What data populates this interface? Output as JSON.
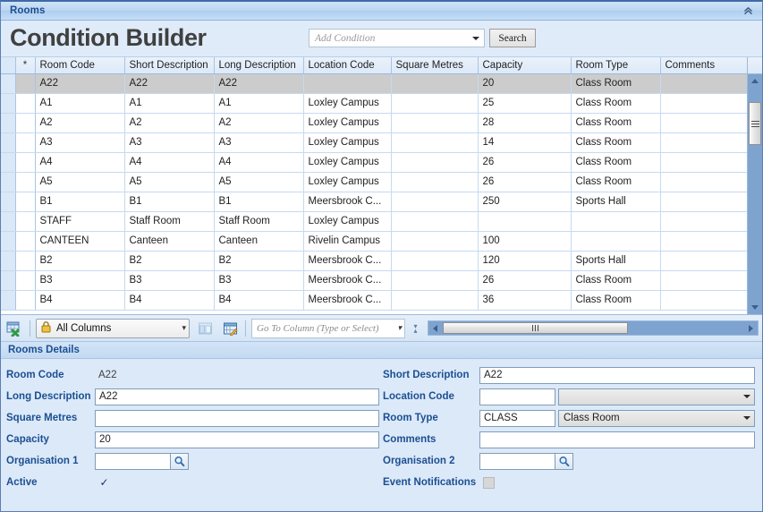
{
  "window": {
    "title": "Rooms",
    "collapse_icon": "chevron-double-up-icon"
  },
  "header": {
    "page_title": "Condition Builder",
    "condition_placeholder": "Add Condition",
    "condition_value": "",
    "search_label": "Search"
  },
  "grid": {
    "star_header": "*",
    "columns": [
      "Room Code",
      "Short Description",
      "Long Description",
      "Location Code",
      "Square Metres",
      "Capacity",
      "Room Type",
      "Comments"
    ],
    "rows": [
      {
        "selected": true,
        "cells": [
          "A22",
          "A22",
          "A22",
          "",
          "",
          "20",
          "Class Room",
          ""
        ]
      },
      {
        "selected": false,
        "cells": [
          "A1",
          "A1",
          "A1",
          "Loxley Campus",
          "",
          "25",
          "Class Room",
          ""
        ]
      },
      {
        "selected": false,
        "cells": [
          "A2",
          "A2",
          "A2",
          "Loxley Campus",
          "",
          "28",
          "Class Room",
          ""
        ]
      },
      {
        "selected": false,
        "cells": [
          "A3",
          "A3",
          "A3",
          "Loxley Campus",
          "",
          "14",
          "Class Room",
          ""
        ]
      },
      {
        "selected": false,
        "cells": [
          "A4",
          "A4",
          "A4",
          "Loxley Campus",
          "",
          "26",
          "Class Room",
          ""
        ]
      },
      {
        "selected": false,
        "cells": [
          "A5",
          "A5",
          "A5",
          "Loxley Campus",
          "",
          "26",
          "Class Room",
          ""
        ]
      },
      {
        "selected": false,
        "cells": [
          "B1",
          "B1",
          "B1",
          "Meersbrook C...",
          "",
          "250",
          "Sports Hall",
          ""
        ]
      },
      {
        "selected": false,
        "cells": [
          "STAFF",
          "Staff Room",
          "Staff Room",
          "Loxley Campus",
          "",
          "",
          "",
          ""
        ]
      },
      {
        "selected": false,
        "cells": [
          "CANTEEN",
          "Canteen",
          "Canteen",
          "Rivelin Campus",
          "",
          "100",
          "",
          ""
        ]
      },
      {
        "selected": false,
        "cells": [
          "B2",
          "B2",
          "B2",
          "Meersbrook C...",
          "",
          "120",
          "Sports Hall",
          ""
        ]
      },
      {
        "selected": false,
        "cells": [
          "B3",
          "B3",
          "B3",
          "Meersbrook C...",
          "",
          "26",
          "Class Room",
          ""
        ]
      },
      {
        "selected": false,
        "cells": [
          "B4",
          "B4",
          "B4",
          "Meersbrook C...",
          "",
          "36",
          "Class Room",
          ""
        ]
      }
    ]
  },
  "toolbar": {
    "export_icon": "export-to-excel-icon",
    "lock_icon": "padlock-icon",
    "column_selector_value": "All Columns",
    "layout_icon": "grid-layout-icon",
    "edit_layout_icon": "grid-layout-edit-icon",
    "goto_column_placeholder": "Go To Column (Type or Select)",
    "goto_column_value": ""
  },
  "details": {
    "header": "Rooms Details",
    "fields": {
      "room_code_label": "Room Code",
      "room_code_value": "A22",
      "short_description_label": "Short Description",
      "short_description_value": "A22",
      "long_description_label": "Long Description",
      "long_description_value": "A22",
      "location_code_label": "Location Code",
      "location_code_value": "",
      "location_name_value": "",
      "square_metres_label": "Square Metres",
      "square_metres_value": "",
      "room_type_label": "Room Type",
      "room_type_code_value": "CLASS",
      "room_type_name_value": "Class Room",
      "capacity_label": "Capacity",
      "capacity_value": "20",
      "comments_label": "Comments",
      "comments_value": "",
      "organisation_1_label": "Organisation 1",
      "organisation_1_value": "",
      "organisation_2_label": "Organisation 2",
      "organisation_2_value": "",
      "active_label": "Active",
      "active_checked": true,
      "event_notifications_label": "Event Notifications",
      "event_notifications_checked": false
    }
  },
  "colors": {
    "accent": "#1b4f92",
    "panel": "#dce9f8",
    "selection": "#cccccc",
    "scrollbar_track": "#7ea3cf"
  }
}
